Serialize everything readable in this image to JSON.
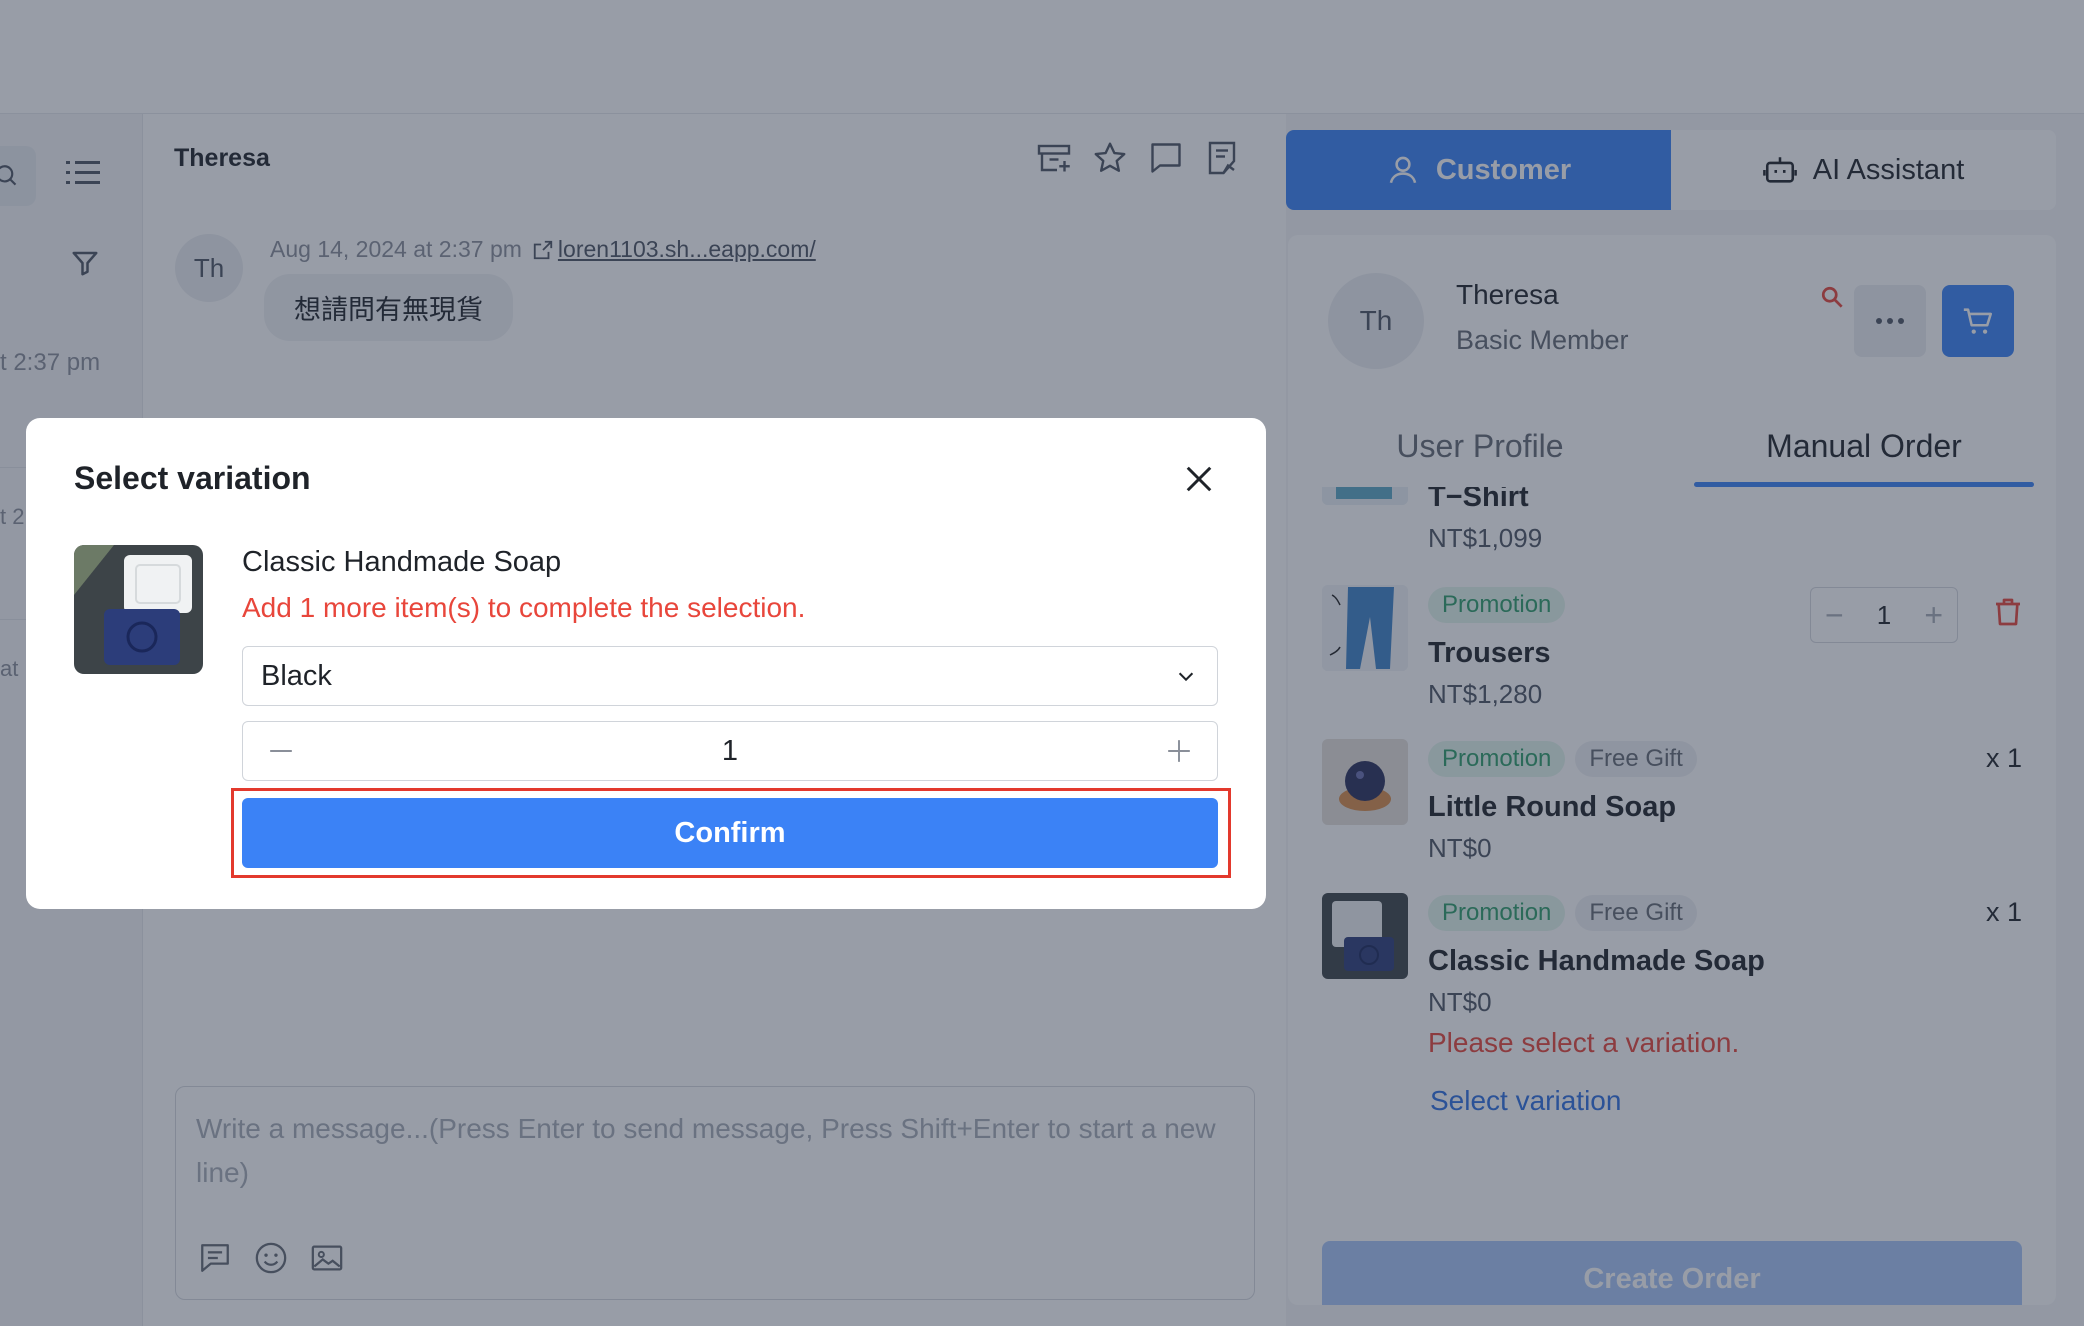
{
  "chat": {
    "contact_name": "Theresa",
    "avatar_initials": "Th",
    "message": {
      "timestamp": "Aug 14, 2024 at 2:37 pm",
      "link": "loren1103.sh...eapp.com/",
      "text": "想請問有無現貨"
    },
    "composer": {
      "placeholder": "Write a message...(Press Enter to send message, Press Shift+Enter to start a new line)"
    }
  },
  "left_panel": {
    "visible_time_fragment": "t 2:37 pm",
    "fragment_2": "t 2",
    "fragment_3": "at"
  },
  "right_panel": {
    "tabs": [
      {
        "label": "Customer",
        "icon": "user-icon",
        "active": true
      },
      {
        "label": "AI Assistant",
        "icon": "robot-icon",
        "active": false
      }
    ],
    "customer": {
      "avatar_initials": "Th",
      "name": "Theresa",
      "tier": "Basic Member"
    },
    "subtabs": [
      {
        "label": "User Profile",
        "active": false
      },
      {
        "label": "Manual Order",
        "active": true
      }
    ],
    "order_items": [
      {
        "name": "T−Shirt",
        "price": "NT$1,099",
        "tags": []
      },
      {
        "name": "Trousers",
        "price": "NT$1,280",
        "tags": [
          "Promotion"
        ],
        "quantity": "1"
      },
      {
        "name": "Little Round Soap",
        "price": "NT$0",
        "tags": [
          "Promotion",
          "Free Gift"
        ],
        "quantity_text": "x 1"
      },
      {
        "name": "Classic Handmade Soap",
        "price": "NT$0",
        "tags": [
          "Promotion",
          "Free Gift"
        ],
        "quantity_text": "x 1",
        "warning": "Please select a variation.",
        "action": "Select variation"
      }
    ],
    "create_order_label": "Create Order"
  },
  "modal": {
    "title": "Select variation",
    "product_name": "Classic Handmade Soap",
    "warning": "Add 1 more item(s) to complete the selection.",
    "selected_variation": "Black",
    "quantity": "1",
    "confirm_label": "Confirm"
  },
  "colors": {
    "accent": "#3b82f6",
    "error": "#e8463b",
    "highlight_border": "#e3392d",
    "promo_tag": "#2f9e6a"
  }
}
